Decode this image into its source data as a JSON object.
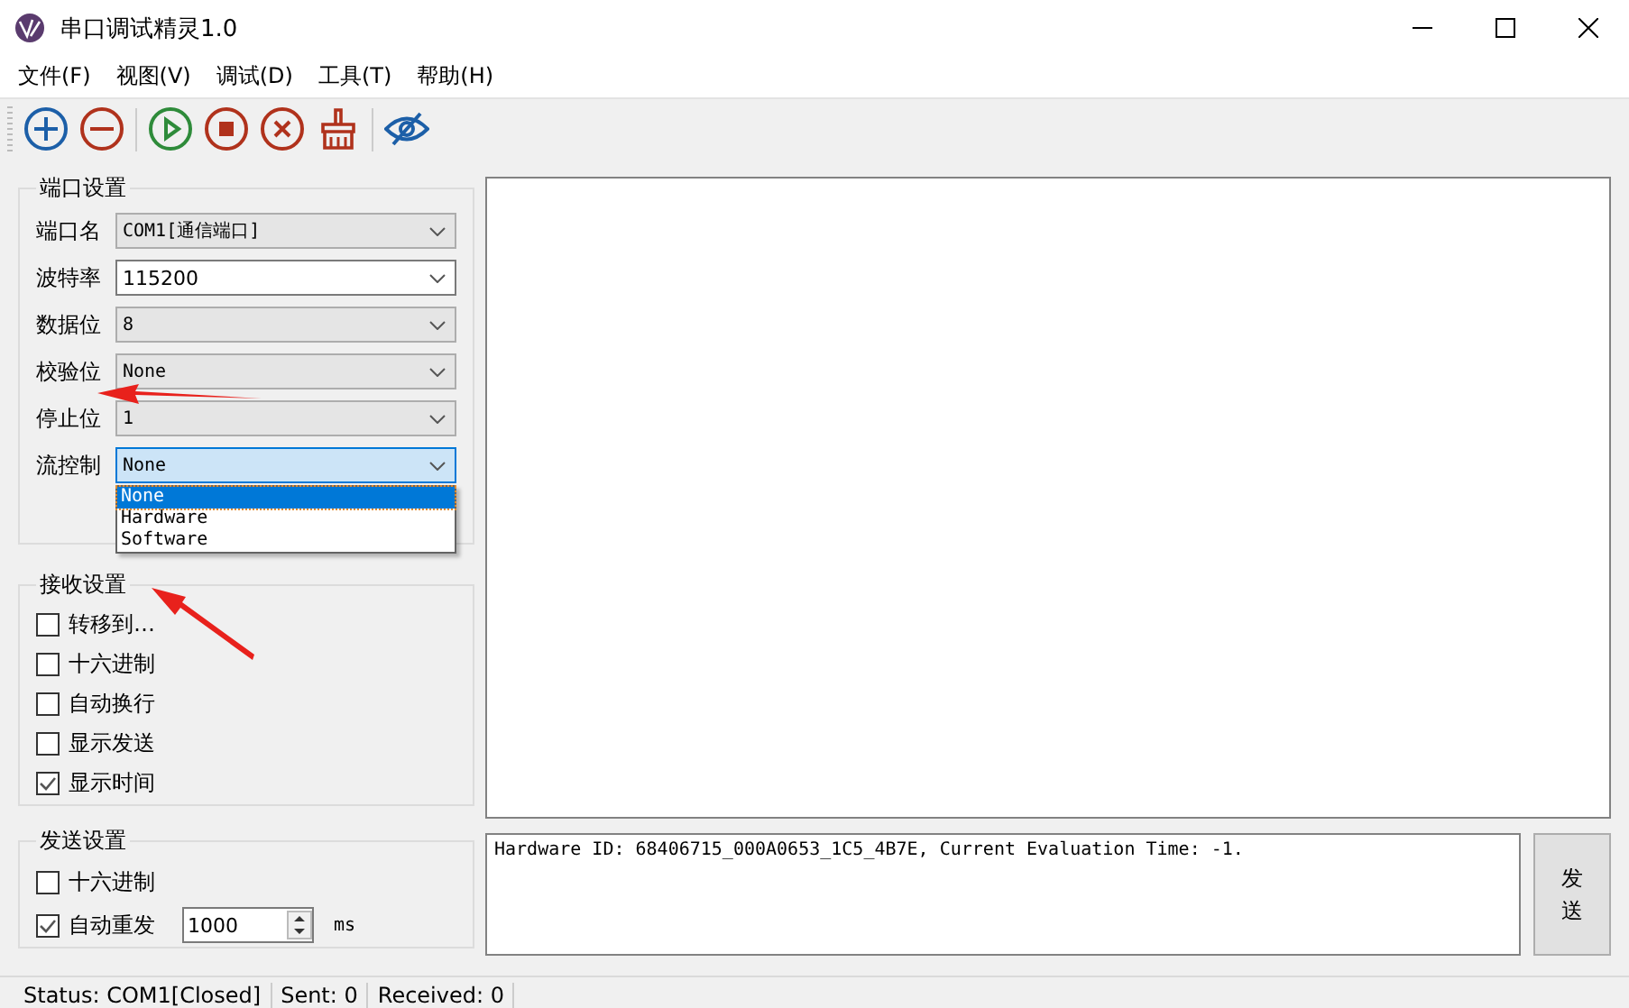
{
  "window": {
    "title": "串口调试精灵1.0"
  },
  "menu": [
    "文件(F)",
    "视图(V)",
    "调试(D)",
    "工具(T)",
    "帮助(H)"
  ],
  "port_settings": {
    "title": "端口设置",
    "fields": [
      {
        "label": "端口名",
        "value": "COM1[通信端口]",
        "kind": "list",
        "expanded": false
      },
      {
        "label": "波特率",
        "value": "115200",
        "kind": "editable",
        "expanded": false
      },
      {
        "label": "数据位",
        "value": "8",
        "kind": "list",
        "expanded": false
      },
      {
        "label": "校验位",
        "value": "None",
        "kind": "list",
        "expanded": false
      },
      {
        "label": "停止位",
        "value": "1",
        "kind": "list",
        "expanded": false
      },
      {
        "label": "流控制",
        "value": "None",
        "kind": "list",
        "expanded": true,
        "options": [
          {
            "label": "None",
            "selected": true
          },
          {
            "label": "Hardware",
            "selected": false
          },
          {
            "label": "Software",
            "selected": false
          }
        ]
      }
    ]
  },
  "receive_settings": {
    "title": "接收设置",
    "options": [
      {
        "label": "转移到…",
        "checked": false
      },
      {
        "label": "十六进制",
        "checked": false
      },
      {
        "label": "自动换行",
        "checked": false
      },
      {
        "label": "显示发送",
        "checked": false
      },
      {
        "label": "显示时间",
        "checked": true
      }
    ]
  },
  "send_settings": {
    "title": "发送设置",
    "options": [
      {
        "label": "十六进制",
        "checked": false,
        "kind": "checkbox"
      },
      {
        "label": "自动重发",
        "checked": true,
        "kind": "repeat",
        "interval": "1000",
        "unit": "ms"
      }
    ]
  },
  "send_box": {
    "value": "Hardware ID: 68406715_000A0653_1C5_4B7E, Current Evaluation Time: -1."
  },
  "send_button": "发送",
  "status_bar": [
    "Status: COM1[Closed]",
    "Sent: 0",
    "Received: 0"
  ]
}
